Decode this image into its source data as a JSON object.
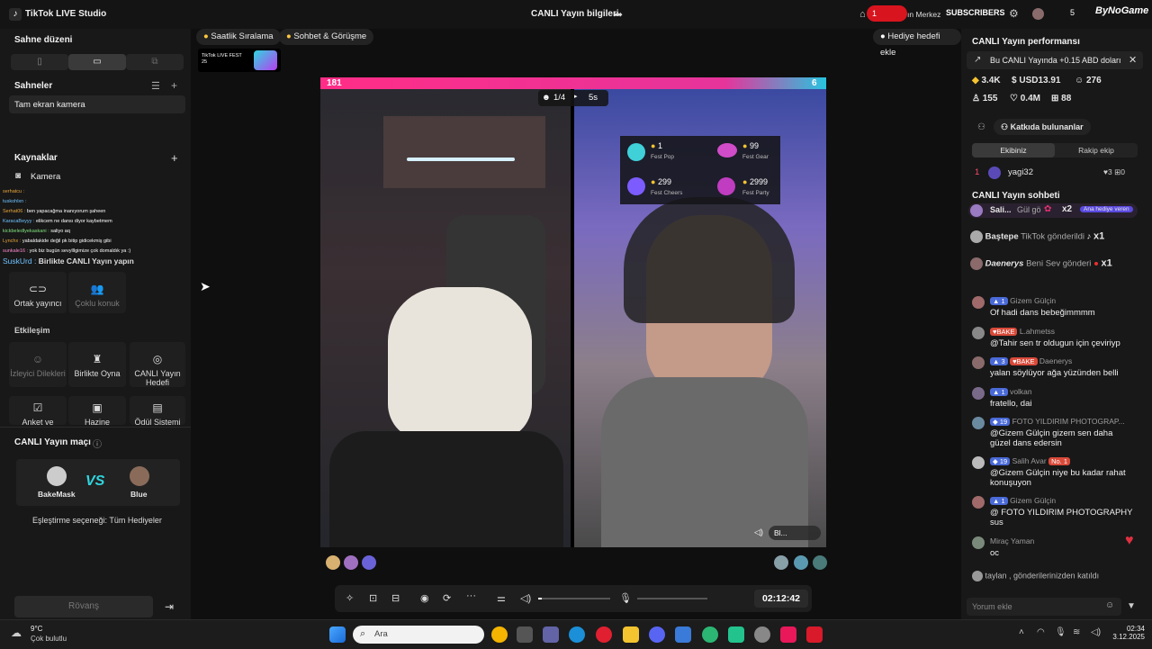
{
  "window": {
    "app_title": "TikTok LIVE Studio",
    "center_title": "CANLI Yayın bilgileri",
    "top_right": {
      "counter": "1",
      "live_center": "ın Merkez",
      "subscribers": "SUBSCRIBERS",
      "count": "5",
      "brand": "ByNoGame"
    }
  },
  "left": {
    "scene_layout_title": "Sahne düzeni",
    "scenes_title": "Sahneler",
    "scene_item": "Tam ekran kamera",
    "sources_title": "Kaynaklar",
    "source_camera": "Kamera",
    "overlay_chat": [
      {
        "user": "serhatcu :",
        "text": ""
      },
      {
        "user": "tuskohlxn :",
        "text": ""
      },
      {
        "user": "Serhat06 :",
        "text": "ben yapacağma inanıyorum şaheen"
      },
      {
        "user": "KaracaBeyyy :",
        "text": "elikcem ne dansı diyor kaybetmem"
      },
      {
        "user": "kickbeledlyekaskani :",
        "text": "saliyo aq"
      },
      {
        "user": "Lynchx :",
        "text": "yabaldakide değil pk bitip gidicekmiş gibi"
      },
      {
        "user": "sunkale16 :",
        "text": "yok biz bugün sevylllgimize çok domaldık ya :)"
      },
      {
        "user": "SuskUrd :",
        "text": "Birlikte CANLI Yayın yapın"
      }
    ],
    "interaction_title": "Etkileşim",
    "cohost_label": "Ortak yayıncı",
    "multi_guest_label": "Çoklu konuk",
    "viewer_requests_label": "İzleyici Dilekleri",
    "play_together_label": "Birlikte Oyna",
    "live_goal_label": "CANLI Yayın Hedefi",
    "poll_label": "Anket ve",
    "treasure_label": "Hazine",
    "reward_label": "Ödül Sistemi",
    "match_title": "CANLI Yayın maçı",
    "player1": "BakeMask",
    "player2": "Blue",
    "vs": "VS",
    "match_option": "Eşleştirme seçeneği: Tüm Hediyeler",
    "rematch_label": "Rövanş"
  },
  "center": {
    "hourly_rank": "Saatlik Sıralama",
    "chat_meet": "Sohbet & Görüşme",
    "gift_goal": "Hediye hedefi ekle",
    "fest_badge": "TikTok LIVE FEST 25",
    "score_left": "181",
    "score_right": "6",
    "round": "1/4",
    "timer_small": "5s",
    "fest_cards": [
      {
        "value": "1",
        "label": "Fest Pop"
      },
      {
        "value": "99",
        "label": "Fest Gear"
      },
      {
        "value": "299",
        "label": "Fest Cheers"
      },
      {
        "value": "2999",
        "label": "Fest Party"
      }
    ],
    "right_cam_tag": "Bl...",
    "elapsed": "02:12:42"
  },
  "right": {
    "perf_title": "CANLI Yayın performansı",
    "earnings_banner": "Bu CANLI Yayında +0.15 ABD doları",
    "stats": {
      "diamonds": "3.4K",
      "usd": "USD13.91",
      "viewers": "276",
      "followers": "155",
      "likes": "0.4M",
      "shares": "88"
    },
    "contrib_title": "Katkıda bulunanlar",
    "tab_team": "Ekibiniz",
    "tab_rival": "Rakip ekip",
    "top_contributor": {
      "rank": "1",
      "name": "yagi32",
      "a": "3",
      "b": "0"
    },
    "chat_title": "CANLI Yayın sohbeti",
    "gifts": [
      {
        "name": "Sali...",
        "text": "Gül gö",
        "count": "x2",
        "badge": "Ana hediye veren"
      },
      {
        "name": "Baştepe",
        "text": "TikTok gönderildi",
        "count": "x1"
      },
      {
        "name": "Daenerys",
        "text": "Beni Sev gönderi",
        "count": "x1"
      }
    ],
    "messages": [
      {
        "level": "1",
        "user": "Gizem Gülçin",
        "text": "Of hadi dans bebeğimmmm"
      },
      {
        "level": "",
        "user": "L.ahmetss",
        "badge": "BAKE",
        "text": "@Tahir sen tr oldugun için çeviriyp"
      },
      {
        "level": "3",
        "user": "Daenerys",
        "badge": "BAKE",
        "text": "yalan söylüyor ağa yüzünden belli"
      },
      {
        "level": "1",
        "user": "volkan",
        "text": "fratello, dai"
      },
      {
        "level": "19",
        "user": "FOTO YILDIRIM PHOTOGRAP...",
        "text": "@Gizem Gülçin gizem sen daha güzel dans edersin"
      },
      {
        "level": "19",
        "user": "Salih Avar",
        "badge": "No. 1",
        "text": "@Gizem Gülçin niye bu kadar rahat konuşuyon"
      },
      {
        "level": "1",
        "user": "Gizem Gülçin",
        "text": "@ FOTO YILDIRIM PHOTOGRAPHY sus"
      },
      {
        "level": "",
        "user": "Miraç Yaman",
        "text": "oc"
      }
    ],
    "join_text": "taylan , gönderilerinizden katıldı",
    "comment_placeholder": "Yorum ekle"
  },
  "taskbar": {
    "weather_temp": "9°C",
    "weather_desc": "Çok bulutlu",
    "search_placeholder": "Ara",
    "time": "02:34",
    "date": "3.12.2025"
  }
}
